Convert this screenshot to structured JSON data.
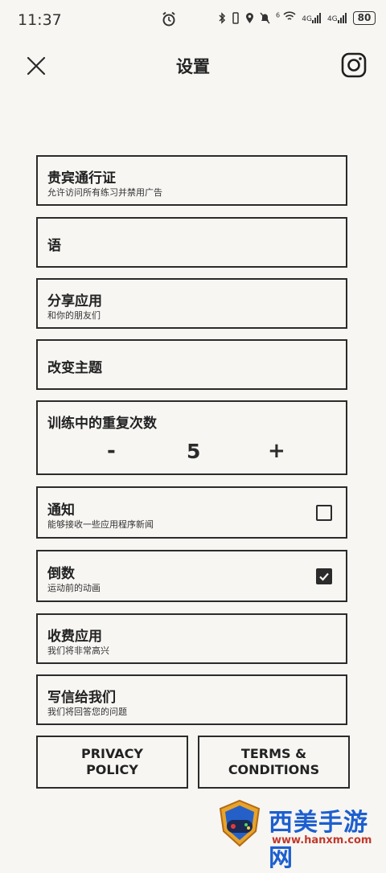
{
  "status_bar": {
    "time": "11:37",
    "network_1": "4G",
    "network_2": "4G",
    "wifi_sup": "6",
    "battery": "80",
    "icons": [
      "alarm-icon",
      "bluetooth-icon",
      "vibrate-icon",
      "location-icon",
      "mute-icon",
      "wifi-icon",
      "signal-icon",
      "signal-icon",
      "battery-icon"
    ]
  },
  "header": {
    "title": "设置",
    "close_icon": "close-icon",
    "instagram_icon": "instagram-icon"
  },
  "settings": {
    "vip": {
      "title": "贵宾通行证",
      "subtitle": "允许访问所有练习并禁用广告"
    },
    "language": {
      "title": "语"
    },
    "share": {
      "title": "分享应用",
      "subtitle": "和你的朋友们"
    },
    "theme": {
      "title": "改变主题"
    },
    "reps": {
      "title": "训练中的重复次数",
      "minus": "-",
      "value": "5",
      "plus": "+"
    },
    "notifications": {
      "title": "通知",
      "subtitle": "能够接收一些应用程序新闻",
      "checked": false
    },
    "countdown": {
      "title": "倒数",
      "subtitle": "运动前的动画",
      "checked": true
    },
    "paid_app": {
      "title": "收费应用",
      "subtitle": "我们将非常高兴"
    },
    "write_us": {
      "title": "写信给我们",
      "subtitle": "我们将回答您的问题"
    }
  },
  "footer": {
    "privacy": "PRIVACY\nPOLICY",
    "terms": "TERMS &\nCONDITIONS"
  },
  "watermark": {
    "text": "西美手游网",
    "url": "www.hanxm.com"
  },
  "colors": {
    "background": "#f7f6f3",
    "foreground": "#2b2b2b",
    "watermark_blue": "#1d5fcf",
    "watermark_red": "#c0392b"
  }
}
